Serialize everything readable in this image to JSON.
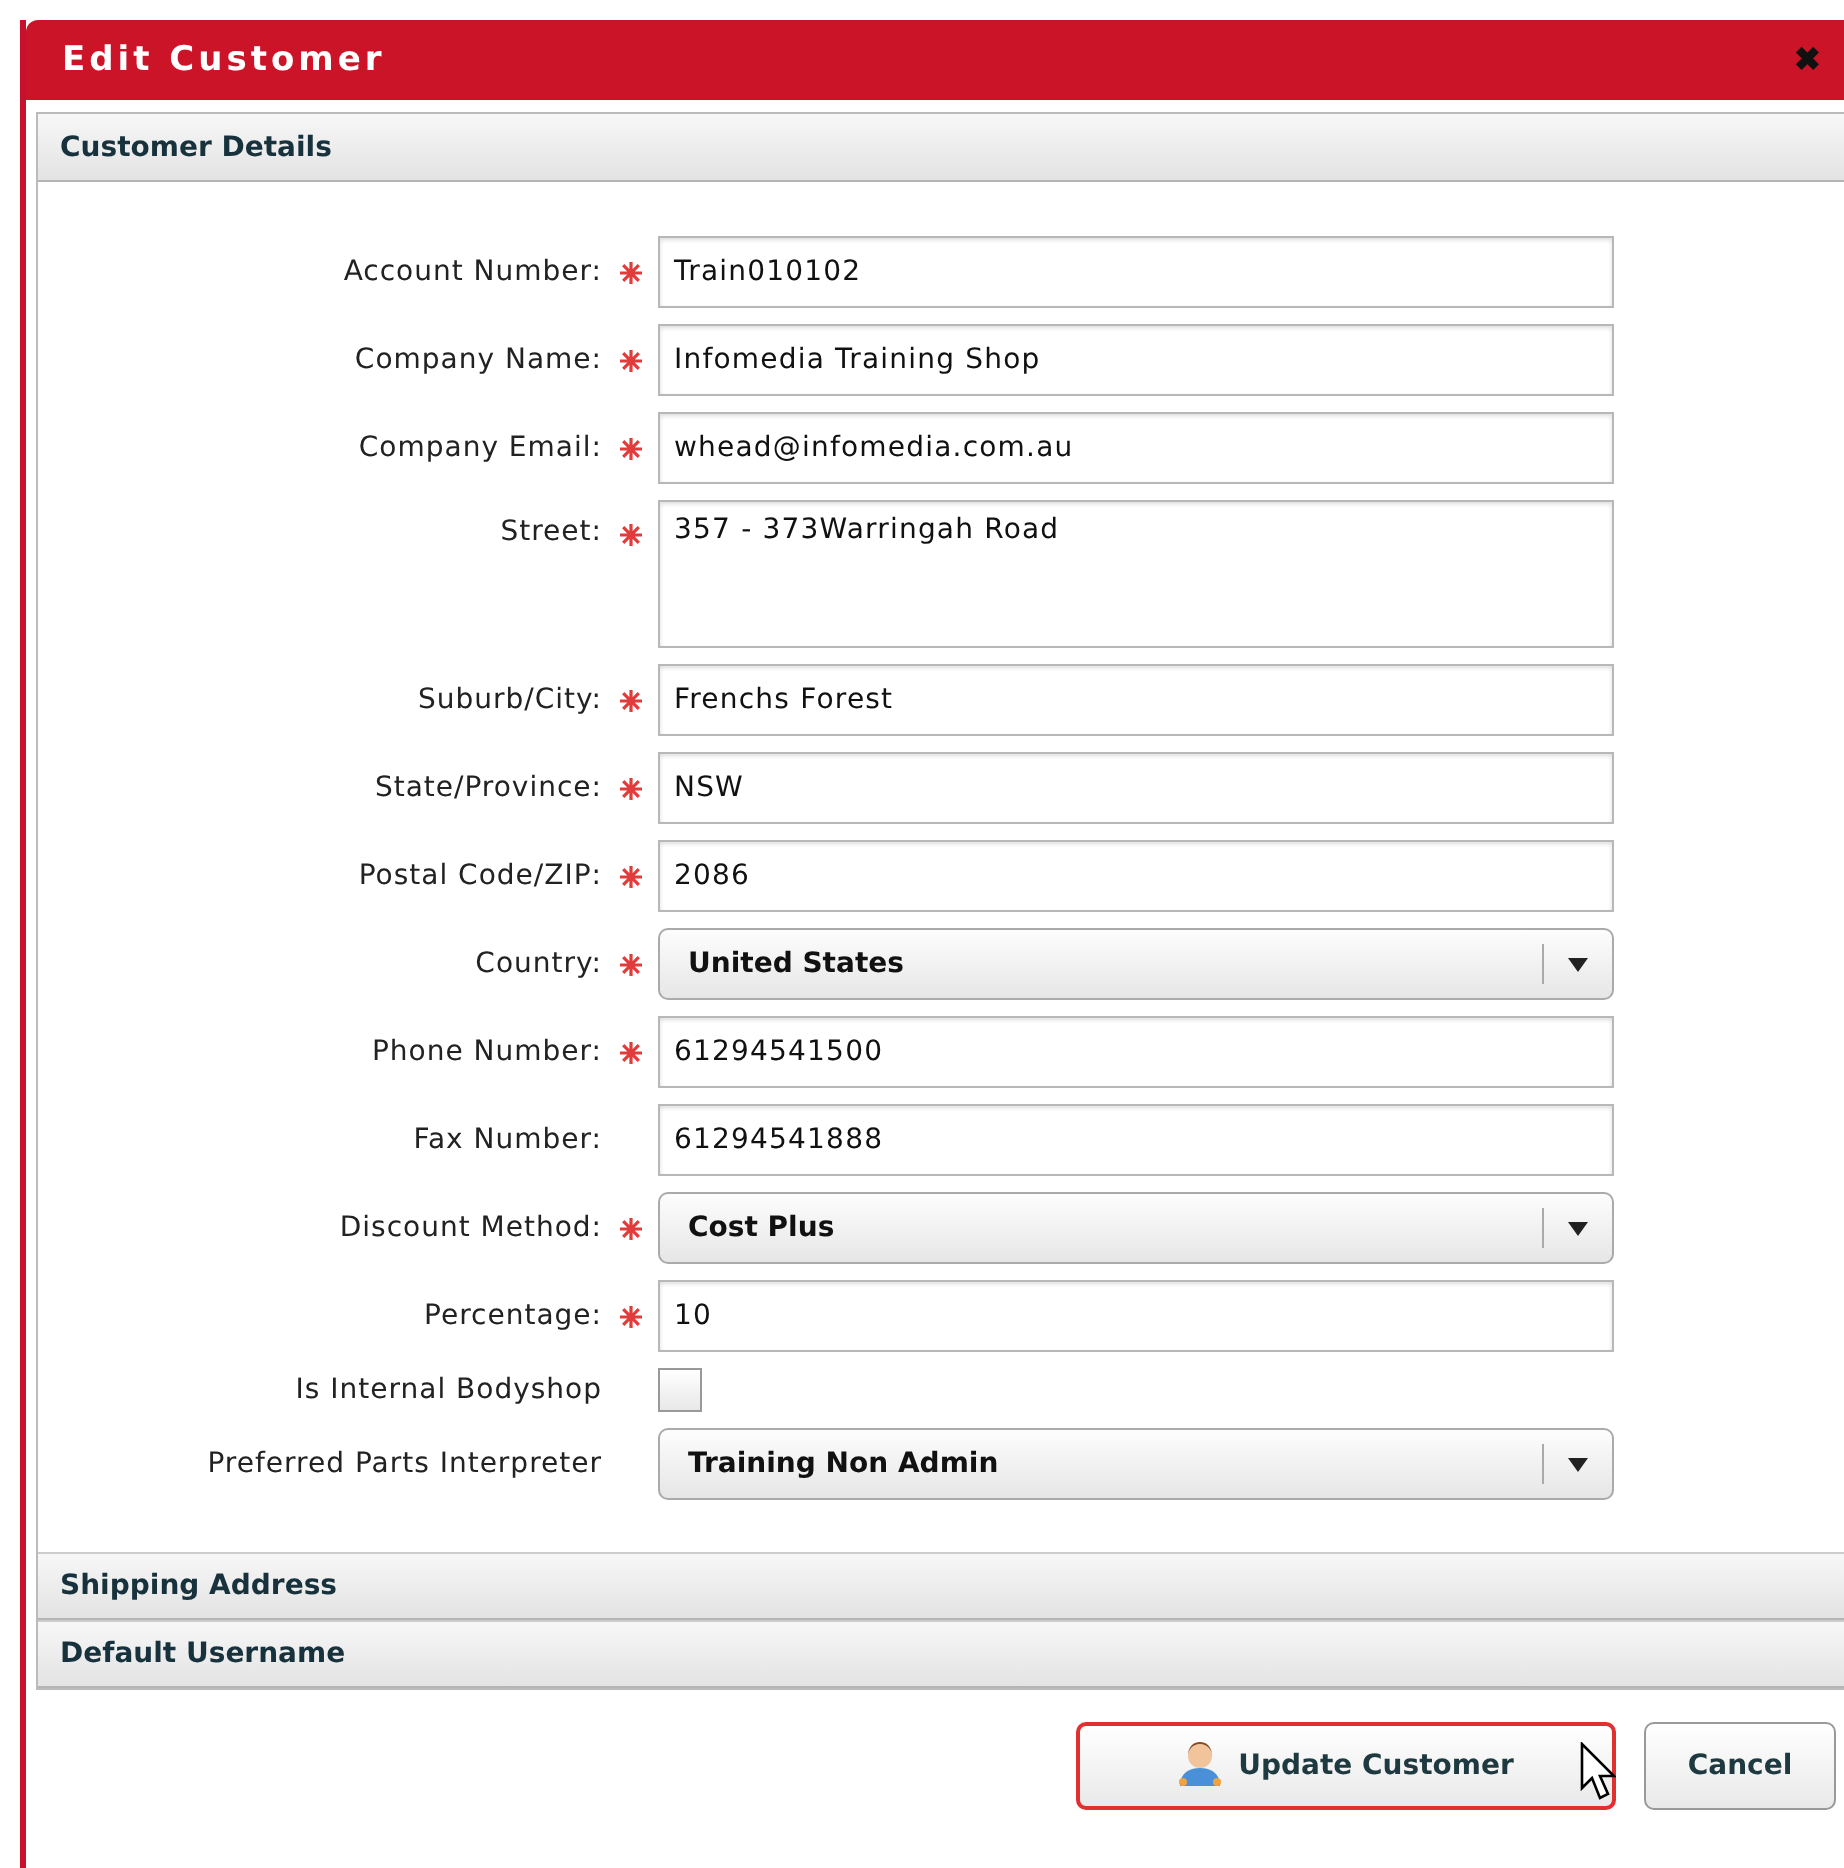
{
  "window": {
    "title": "Edit Customer",
    "close": "✖"
  },
  "sections": [
    {
      "title": "Customer Details",
      "expanded": true
    },
    {
      "title": "Shipping Address",
      "expanded": false
    },
    {
      "title": "Default Username",
      "expanded": false
    }
  ],
  "fields": [
    {
      "kind": "text",
      "label": "Account Number:",
      "required": true,
      "value": "Train010102"
    },
    {
      "kind": "text",
      "label": "Company Name:",
      "required": true,
      "value": "Infomedia Training Shop"
    },
    {
      "kind": "text",
      "label": "Company Email:",
      "required": true,
      "value": "whead@infomedia.com.au"
    },
    {
      "kind": "textarea",
      "label": "Street:",
      "required": true,
      "value": "357 - 373Warringah Road"
    },
    {
      "kind": "text",
      "label": "Suburb/City:",
      "required": true,
      "value": "Frenchs Forest"
    },
    {
      "kind": "text",
      "label": "State/Province:",
      "required": true,
      "value": "NSW"
    },
    {
      "kind": "text",
      "label": "Postal Code/ZIP:",
      "required": true,
      "value": "2086"
    },
    {
      "kind": "select",
      "label": "Country:",
      "required": true,
      "value": "United States"
    },
    {
      "kind": "text",
      "label": "Phone Number:",
      "required": true,
      "value": "61294541500"
    },
    {
      "kind": "text",
      "label": "Fax Number:",
      "required": false,
      "value": "61294541888"
    },
    {
      "kind": "select",
      "label": "Discount Method:",
      "required": true,
      "value": "Cost Plus"
    },
    {
      "kind": "text",
      "label": "Percentage:",
      "required": true,
      "value": "10"
    },
    {
      "kind": "checkbox",
      "label": "Is Internal Bodyshop",
      "required": false,
      "checked": false
    },
    {
      "kind": "select",
      "label": "Preferred Parts Interpreter",
      "required": false,
      "value": "Training Non Admin"
    }
  ],
  "buttons": [
    {
      "label": "Update Customer",
      "kind": "primary"
    },
    {
      "label": "Cancel",
      "kind": "plain"
    }
  ]
}
